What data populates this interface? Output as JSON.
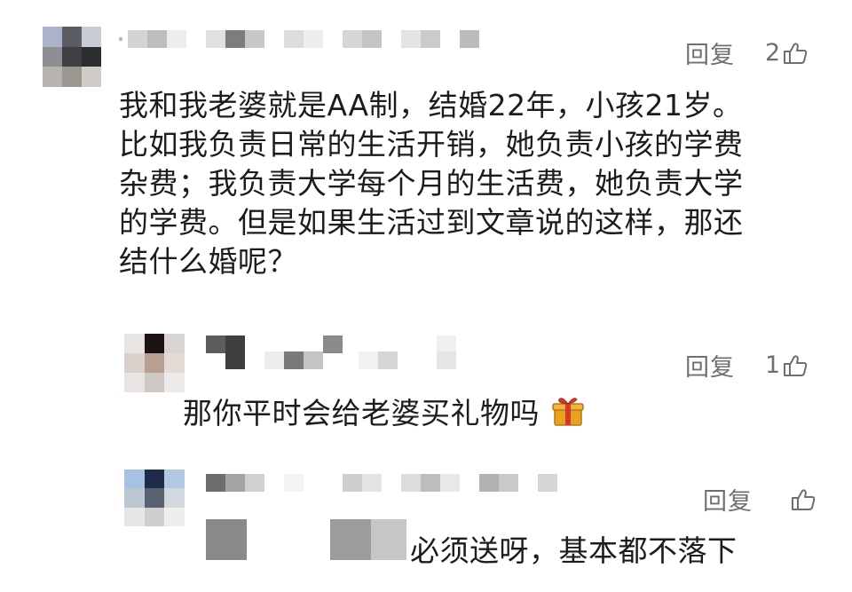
{
  "comments": [
    {
      "reply_label": "回复",
      "like_count": "2",
      "text_lines": [
        "我和我老婆就是AA制，结婚22年，小孩21岁。",
        "比如我负责日常的生活开销，她负责小孩的学费",
        "杂费；我负责大学每个月的生活费，她负责大学",
        "的学费。但是如果生活过到文章说的这样，那还",
        "结什么婚呢？"
      ]
    },
    {
      "reply_label": "回复",
      "like_count": "1",
      "text": "那你平时会给老婆买礼物吗"
    },
    {
      "reply_label": "回复",
      "like_count": "",
      "text": "必须送呀，基本都不落下"
    }
  ],
  "icons": {
    "like": "thumbs-up-outline-icon",
    "gift": "gift-box-emoji-icon"
  },
  "colors": {
    "text": "#1c1c1c",
    "muted": "#6f6f6f",
    "gift": "#e8a21e"
  }
}
